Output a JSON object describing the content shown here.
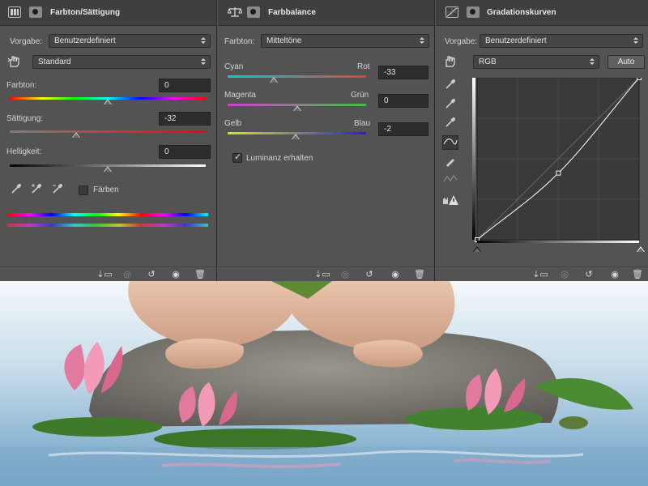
{
  "hue_saturation": {
    "title": "Farbton/Sättigung",
    "preset_label": "Vorgabe:",
    "preset_value": "Benutzerdefiniert",
    "channel_value": "Standard",
    "hue_label": "Farbton:",
    "hue_value": "0",
    "saturation_label": "Sättigung:",
    "saturation_value": "-32",
    "lightness_label": "Helligkeit:",
    "lightness_value": "0",
    "colorize_label": "Färben",
    "colorize_checked": false,
    "sliders": {
      "hue": 0,
      "saturation": -32,
      "lightness": 0
    }
  },
  "color_balance": {
    "title": "Farbbalance",
    "tone_label": "Farbton:",
    "tone_value": "Mitteltöne",
    "cyan_label": "Cyan",
    "red_label": "Rot",
    "cyan_red_value": "-33",
    "magenta_label": "Magenta",
    "green_label": "Grün",
    "magenta_green_value": "0",
    "yellow_label": "Gelb",
    "blue_label": "Blau",
    "yellow_blue_value": "-2",
    "preserve_luminosity_label": "Luminanz erhalten",
    "preserve_luminosity_checked": true,
    "sliders": {
      "cyan_red": -33,
      "magenta_green": 0,
      "yellow_blue": -2
    }
  },
  "curves": {
    "title": "Gradationskurven",
    "preset_label": "Vorgabe:",
    "preset_value": "Benutzerdefiniert",
    "channel_value": "RGB",
    "auto_label": "Auto",
    "points": [
      [
        0,
        0
      ],
      [
        128,
        105
      ],
      [
        255,
        255
      ]
    ]
  },
  "footer_icons": [
    "clip-to-layer-icon",
    "view-previous-icon",
    "reset-icon",
    "visibility-eye-icon",
    "trash-icon"
  ],
  "colors": {
    "panel_bg": "#535353",
    "title_bg": "#3f3f3f",
    "field_bg": "#2d2d2d"
  }
}
